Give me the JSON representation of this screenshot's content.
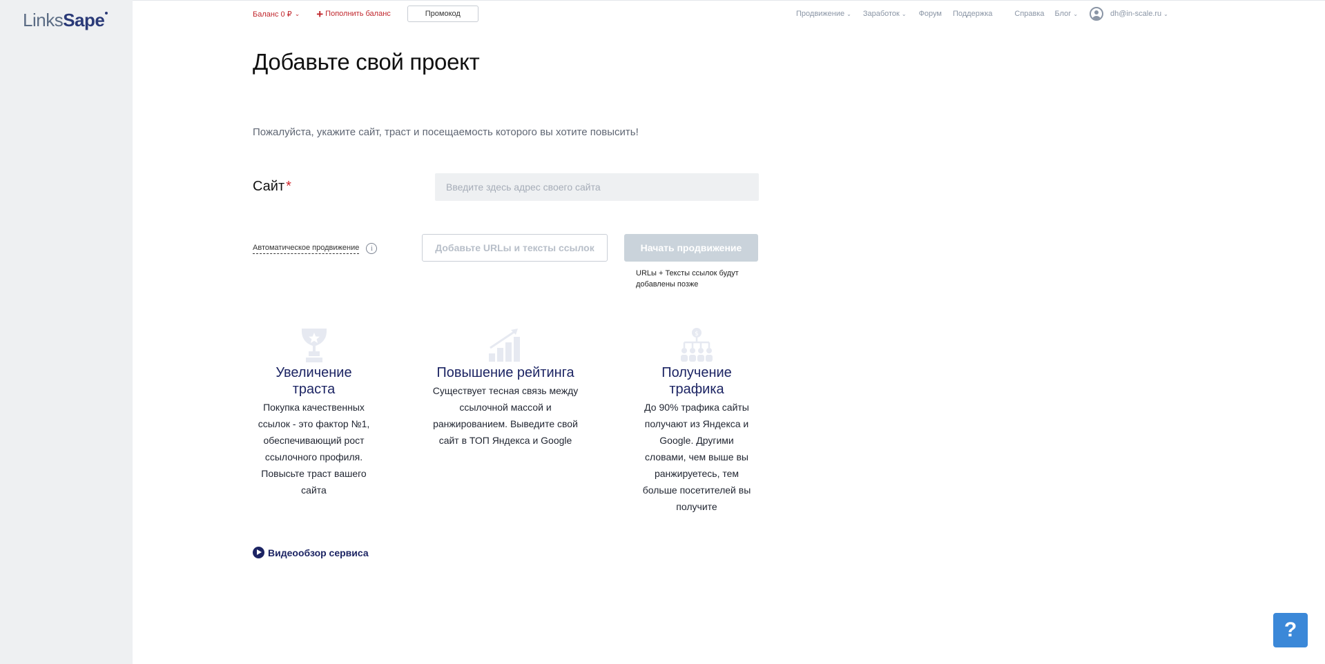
{
  "brand": {
    "logo_part1": "Links",
    "logo_part2": "Sape"
  },
  "topbar": {
    "balance": "Баланс 0 ₽",
    "topup": "Пополнить баланс",
    "promo": "Промокод"
  },
  "nav": {
    "promotion": "Продвижение",
    "earnings": "Заработок",
    "forum": "Форум",
    "support": "Поддержка",
    "help": "Справка",
    "blog": "Блог",
    "user_email": "dh@in-scale.ru"
  },
  "page": {
    "title": "Добавьте свой проект",
    "subtitle": "Пожалуйста, укажите сайт, траст и посещаемость которого вы хотите повысить!"
  },
  "form": {
    "site_label": "Сайт",
    "required_mark": "*",
    "site_value": "",
    "site_placeholder": "Введите здесь адрес своего сайта",
    "auto_promotion": "Автоматическое продвижение",
    "info_symbol": "i",
    "add_urls": "Добавьте URLы и тексты ссылок",
    "start": "Начать продвижение",
    "start_note": "URLы + Тексты ссылок будут добавлены позже"
  },
  "features": [
    {
      "icon": "trophy-icon",
      "title": "Увеличение траста",
      "text": "Покупка качественных ссылок - это фактор №1, обеспечивающий рост ссылочного профиля. Повысьте траст вашего сайта"
    },
    {
      "icon": "growth-chart-icon",
      "title": "Повышение рейтинга",
      "text": "Существует тесная связь между ссылочной массой и ранжированием. Выведите свой сайт в ТОП Яндекса и Google"
    },
    {
      "icon": "traffic-network-icon",
      "title": "Получение трафика",
      "text": "До 90% трафика сайты получают из Яндекса и Google. Другими словами, чем выше вы ранжируетесь, тем больше посетителей вы получите"
    }
  ],
  "video": {
    "label": "Видеообзор сервиса"
  },
  "help_button": {
    "label": "?"
  },
  "colors": {
    "accent_red": "#c0262c",
    "navy": "#1c2463",
    "sidebar_bg": "#eef0f2",
    "help_blue": "#3b88d8",
    "feature_icon": "#e6e9f1"
  }
}
